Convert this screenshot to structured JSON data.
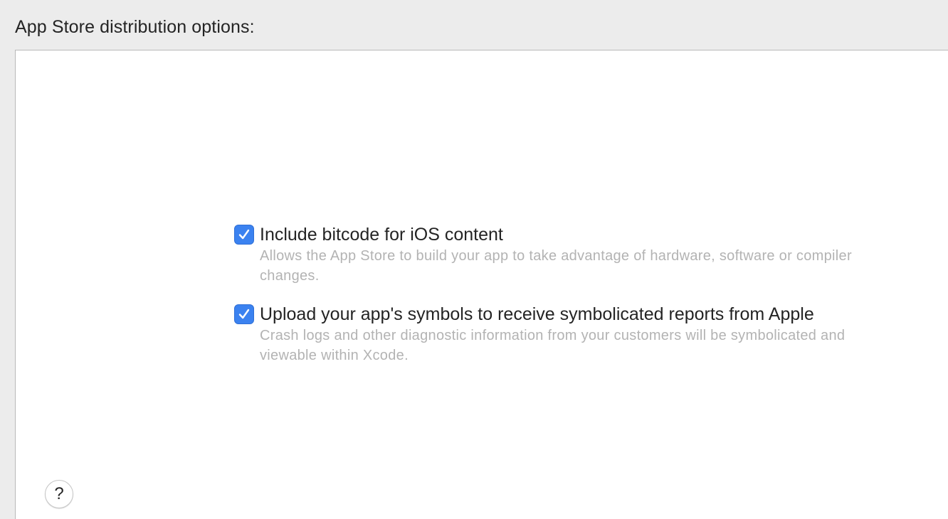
{
  "header": {
    "title": "App Store distribution options:"
  },
  "options": [
    {
      "label": "Include bitcode for iOS content",
      "description": "Allows the App Store to build your app to take advantage of hardware, software or compiler changes.",
      "checked": true
    },
    {
      "label": "Upload your app's symbols to receive symbolicated reports from Apple",
      "description": "Crash logs and other diagnostic information from your customers will be symbolicated and viewable within Xcode.",
      "checked": true
    }
  ],
  "help": {
    "label": "?"
  },
  "colors": {
    "checkbox_accent": "#3b82f0",
    "panel_background": "#ffffff",
    "window_background": "#ececec",
    "description_text": "#b3b3b3"
  }
}
